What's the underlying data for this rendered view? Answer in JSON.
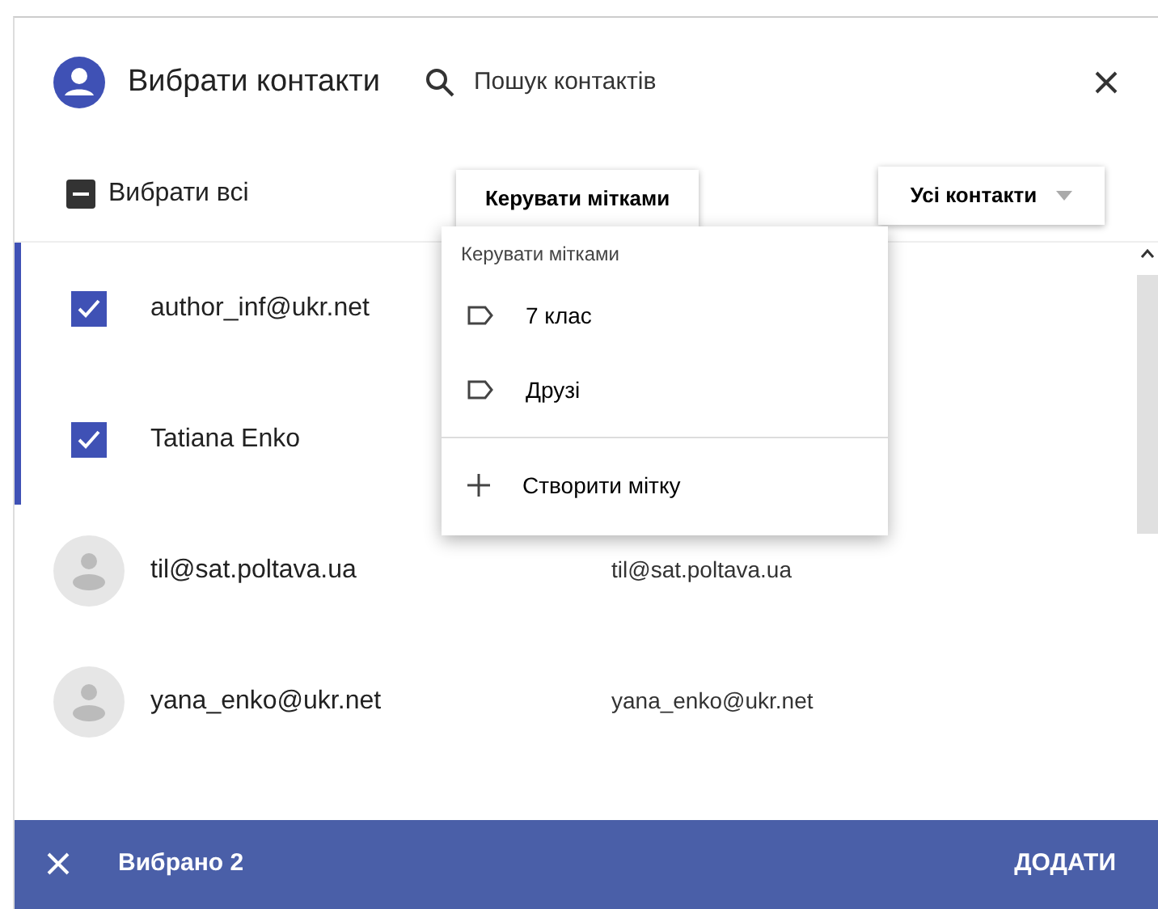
{
  "header": {
    "title": "Вибрати контакти",
    "search": {
      "placeholder": "Пошук контактів"
    }
  },
  "toolbar": {
    "select_all": {
      "label": "Вибрати всі",
      "indeterminate": true
    },
    "manage_labels": {
      "label": "Керувати мітками",
      "expanded": true
    },
    "filter": {
      "label": "Усі контакти"
    }
  },
  "menu": {
    "heading": "Керувати мітками",
    "items": [
      {
        "kind": "label",
        "text": "7 клас"
      },
      {
        "kind": "label",
        "text": "Друзі"
      },
      {
        "kind": "create",
        "text": "Створити мітку"
      }
    ]
  },
  "contacts": [
    {
      "name": "author_inf@ukr.net",
      "selected": true
    },
    {
      "name": "Tatiana Enko",
      "selected": true
    },
    {
      "name": "til@sat.poltava.ua",
      "email": "til@sat.poltava.ua",
      "selected": false
    },
    {
      "name": "yana_enko@ukr.net",
      "email": "yana_enko@ukr.net",
      "selected": false
    }
  ],
  "footer": {
    "count": "Вибрано 2",
    "action": "ДОДАТИ"
  }
}
